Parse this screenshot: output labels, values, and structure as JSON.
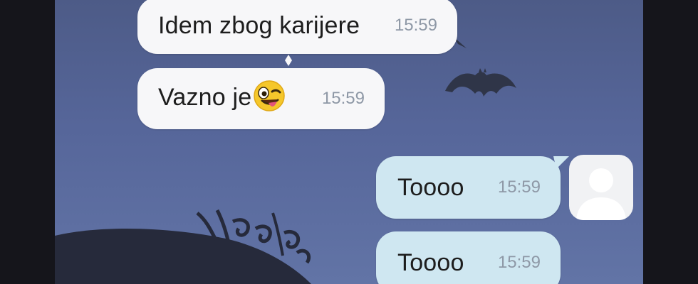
{
  "messages": [
    {
      "direction": "incoming",
      "text": "Idem zbog karijere",
      "time": "15:59"
    },
    {
      "direction": "incoming",
      "text": "Vazno je",
      "emoji": "winking-tongue-emoji",
      "time": "15:59"
    },
    {
      "direction": "outgoing",
      "text": "Toooo",
      "time": "15:59"
    },
    {
      "direction": "outgoing",
      "text": "Toooo",
      "time": "15:59"
    }
  ],
  "colors": {
    "background": "#56669a",
    "incoming_bubble": "#f7f7f9",
    "outgoing_bubble": "#cfe7f1",
    "timestamp": "#8e98a6"
  },
  "icons": [
    "bat-icon",
    "user-avatar-icon",
    "winking-tongue-emoji"
  ]
}
